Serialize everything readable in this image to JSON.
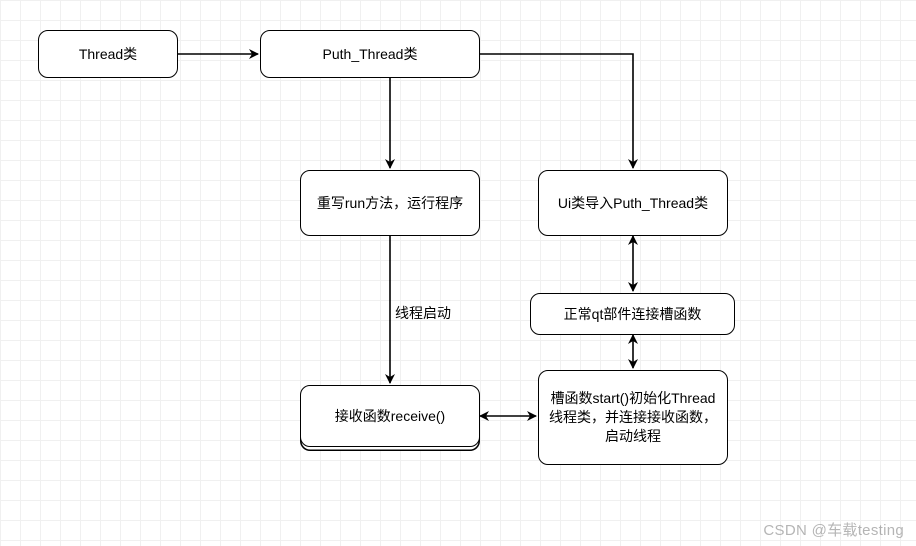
{
  "chart_data": {
    "type": "diagram",
    "title": "",
    "nodes": [
      {
        "id": "thread",
        "label": "Thread类"
      },
      {
        "id": "puth",
        "label": "Puth_Thread类"
      },
      {
        "id": "run",
        "label": "重写run方法，运行程序"
      },
      {
        "id": "uiimport",
        "label": "Ui类导入Puth_Thread类"
      },
      {
        "id": "qtslot",
        "label": "正常qt部件连接槽函数"
      },
      {
        "id": "receive",
        "label": "接收函数receive()"
      },
      {
        "id": "start",
        "label": "槽函数start()初始化Thread线程类，并连接接收函数，启动线程"
      }
    ],
    "edges": [
      {
        "from": "thread",
        "to": "puth",
        "dir": "forward",
        "label": ""
      },
      {
        "from": "puth",
        "to": "run",
        "dir": "forward",
        "label": ""
      },
      {
        "from": "puth",
        "to": "uiimport",
        "dir": "forward",
        "label": ""
      },
      {
        "from": "run",
        "to": "receive",
        "dir": "forward",
        "label": "线程启动"
      },
      {
        "from": "uiimport",
        "to": "qtslot",
        "dir": "both",
        "label": ""
      },
      {
        "from": "qtslot",
        "to": "start",
        "dir": "both",
        "label": ""
      },
      {
        "from": "receive",
        "to": "start",
        "dir": "both",
        "label": ""
      }
    ]
  },
  "nodes": {
    "thread": {
      "label": "Thread类"
    },
    "puth": {
      "label": "Puth_Thread类"
    },
    "run": {
      "label": "重写run方法，运行程序"
    },
    "uiimport": {
      "label": "Ui类导入Puth_Thread类"
    },
    "qtslot": {
      "label": "正常qt部件连接槽函数"
    },
    "receive": {
      "label": "接收函数receive()"
    },
    "start": {
      "label": "槽函数start()初始化Thread线程类，并连接接收函数，启动线程"
    }
  },
  "edge_labels": {
    "run_to_receive": "线程启动"
  },
  "watermark": "CSDN @车载testing"
}
